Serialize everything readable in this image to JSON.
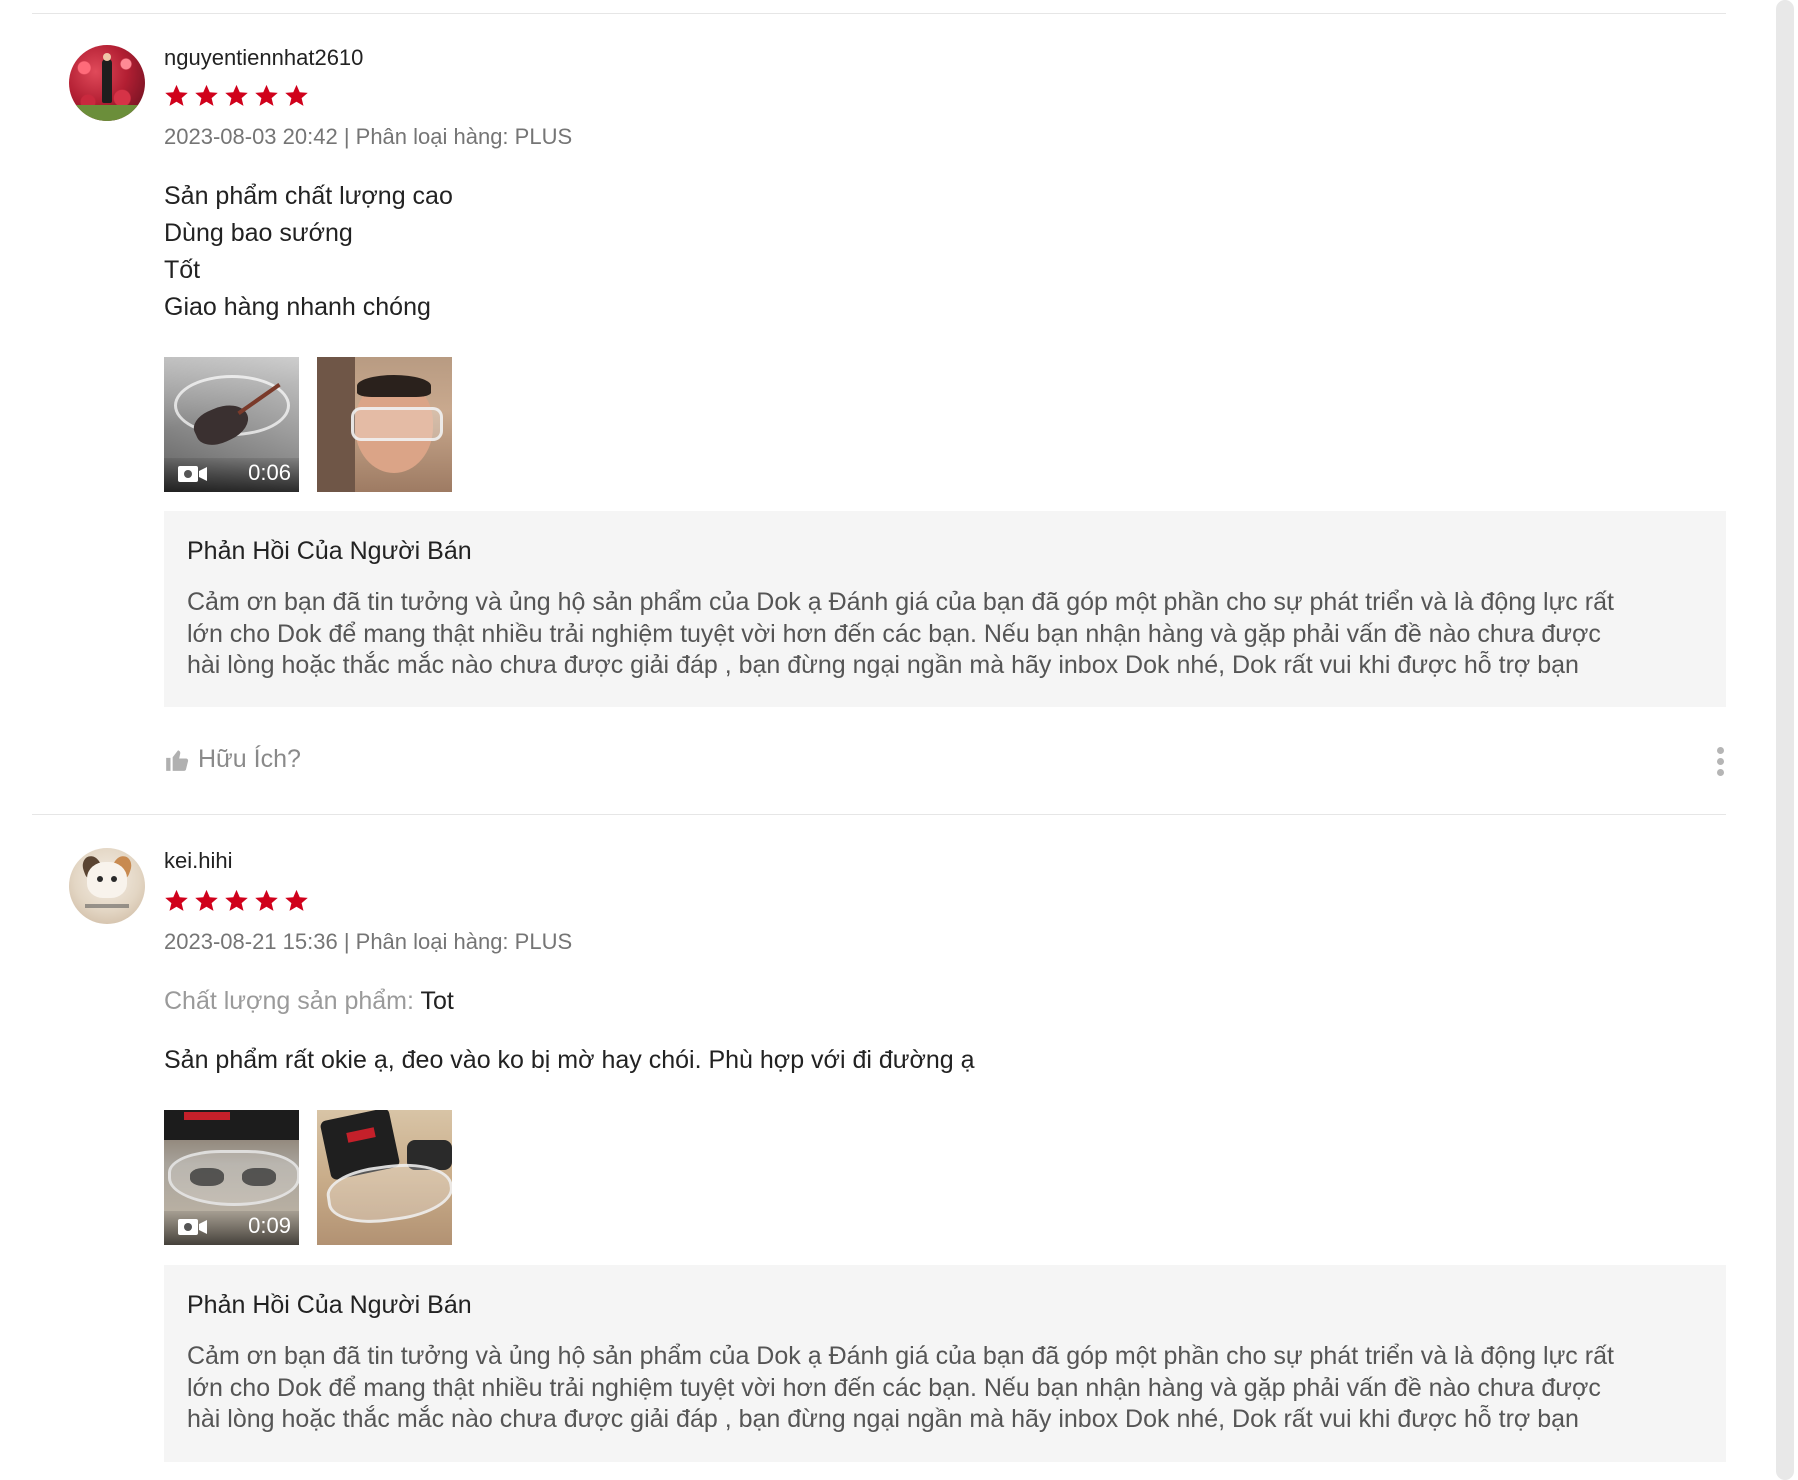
{
  "reviews": [
    {
      "username": "nguyentiennhat2610",
      "rating": 5,
      "meta": "2023-08-03 20:42 | Phân loại hàng: PLUS",
      "body_lines": [
        "Sản phẩm chất lượng cao",
        "Dùng bao sướng",
        "Tốt",
        "Giao hàng nhanh chóng"
      ],
      "media": [
        {
          "type": "video",
          "duration": "0:06",
          "icon": "video-camera-icon"
        },
        {
          "type": "image"
        }
      ],
      "seller_reply": {
        "title": "Phản Hồi Của Người Bán",
        "lines": [
          "Cảm ơn bạn đã tin tưởng và ủng hộ sản phẩm của Dok ạ Đánh giá của bạn đã góp một phần cho sự phát triển và là động lực rất",
          "lớn cho Dok để mang thật nhiều trải nghiệm tuyệt vời hơn đến các bạn. Nếu bạn nhận hàng và gặp phải vấn đề nào chưa được",
          "hài lòng hoặc thắc mắc nào chưa được giải đáp , bạn đừng ngại ngần mà hãy inbox Dok nhé, Dok rất vui khi được hỗ trợ bạn"
        ]
      },
      "helpful_label": "Hữu Ích?"
    },
    {
      "username": "kei.hihi",
      "rating": 5,
      "meta": "2023-08-21 15:36 | Phân loại hàng: PLUS",
      "quality_label": "Chất lượng sản phẩm:",
      "quality_value": "Tot",
      "body_lines": [
        "Sản phẩm rất okie ạ, đeo vào ko bị mờ hay chói. Phù hợp với đi đường ạ"
      ],
      "media": [
        {
          "type": "video",
          "duration": "0:09",
          "icon": "video-camera-icon"
        },
        {
          "type": "image"
        }
      ],
      "seller_reply": {
        "title": "Phản Hồi Của Người Bán",
        "lines": [
          "Cảm ơn bạn đã tin tưởng và ủng hộ sản phẩm của Dok ạ Đánh giá của bạn đã góp một phần cho sự phát triển và là động lực rất",
          "lớn cho Dok để mang thật nhiều trải nghiệm tuyệt vời hơn đến các bạn. Nếu bạn nhận hàng và gặp phải vấn đề nào chưa được",
          "hài lòng hoặc thắc mắc nào chưa được giải đáp , bạn đừng ngại ngần mà hãy inbox Dok nhé, Dok rất vui khi được hỗ trợ bạn"
        ]
      }
    }
  ],
  "colors": {
    "star": "#d0011b",
    "meta_text": "#757575",
    "reply_bg": "#f5f5f5",
    "divider": "#e6e6e6"
  }
}
